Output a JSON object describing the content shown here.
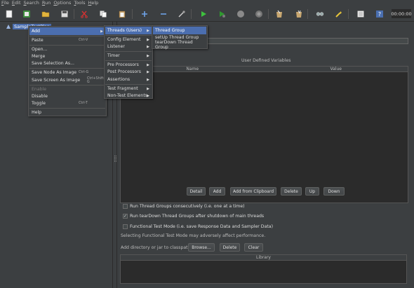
{
  "menubar": [
    "File",
    "Edit",
    "Search",
    "Run",
    "Options",
    "Tools",
    "Help"
  ],
  "toolbar": {
    "timer": "00:00:00",
    "icons": [
      "new-icon",
      "templates-icon",
      "open-icon",
      "save-icon",
      "cut-icon",
      "copy-icon",
      "paste-icon",
      "expand-icon",
      "collapse-icon",
      "toggle-icon",
      "start-icon",
      "start-no-timers-icon",
      "stop-icon",
      "shutdown-icon",
      "clear-icon",
      "clear-all-icon",
      "search-icon",
      "reset-search-icon",
      "function-helper-icon",
      "help-icon"
    ]
  },
  "tree": {
    "root": "SampleTestPlan"
  },
  "context_menu": {
    "items": [
      {
        "label": "Add",
        "shortcut": "",
        "submenu": true
      },
      {
        "label": "Paste",
        "shortcut": "Ctrl-V"
      },
      {
        "label": "Open..."
      },
      {
        "label": "Merge"
      },
      {
        "label": "Save Selection As..."
      },
      {
        "label": "Save Node As Image",
        "shortcut": "Ctrl-G"
      },
      {
        "label": "Save Screen As Image",
        "shortcut": "Ctrl+Shift-G"
      },
      {
        "label": "Enable"
      },
      {
        "label": "Disable"
      },
      {
        "label": "Toggle",
        "shortcut": "Ctrl-T"
      },
      {
        "label": "Help"
      }
    ]
  },
  "add_menu": {
    "items": [
      "Threads (Users)",
      "Config Element",
      "Listener",
      "Timer",
      "Pre Processors",
      "Post Processors",
      "Assertions",
      "Test Fragment",
      "Non-Test Elements"
    ]
  },
  "threads_menu": {
    "items": [
      "Thread Group",
      "setUp Thread Group",
      "tearDown Thread Group"
    ]
  },
  "main": {
    "udv_title": "User Defined Variables",
    "col_name": "Name",
    "col_value": "Value",
    "buttons": {
      "detail": "Detail",
      "add": "Add",
      "add_clip": "Add from Clipboard",
      "delete": "Delete",
      "up": "Up",
      "down": "Down"
    },
    "checks": [
      {
        "label": "Run Thread Groups consecutively (i.e. one at a time)",
        "checked": false
      },
      {
        "label": "Run tearDown Thread Groups after shutdown of main threads",
        "checked": true
      },
      {
        "label": "Functional Test Mode (i.e. save Response Data and Sampler Data)",
        "checked": false
      }
    ],
    "warning": "Selecting Functional Test Mode may adversely affect performance.",
    "classpath_label": "Add directory or jar to classpath",
    "browse": "Browse...",
    "cp_delete": "Delete",
    "clear": "Clear",
    "library_col": "Library"
  }
}
